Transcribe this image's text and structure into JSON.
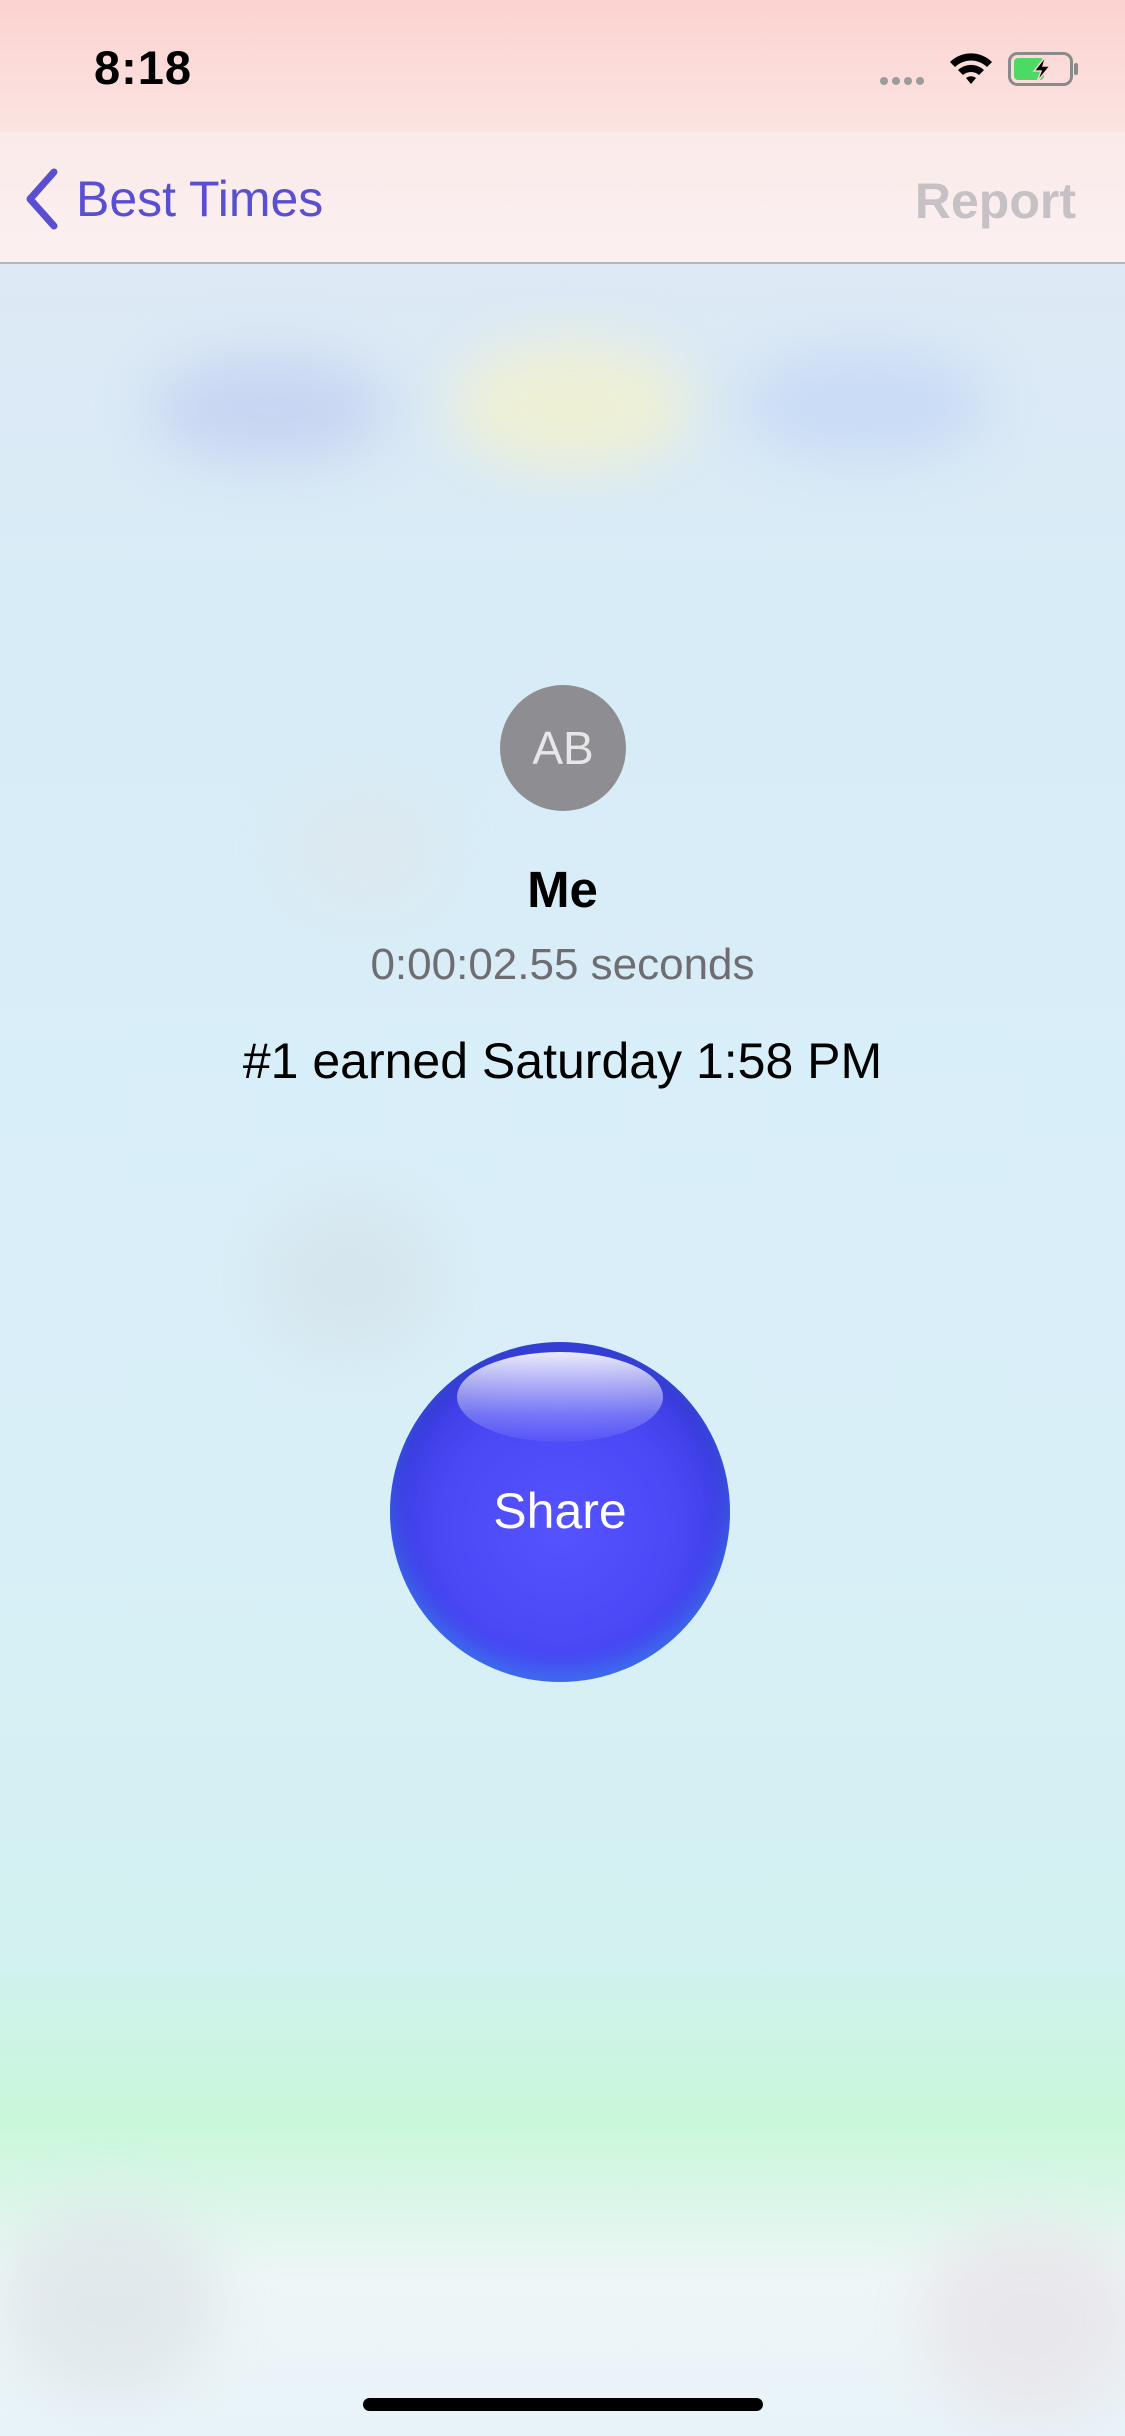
{
  "status_bar": {
    "time": "8:18",
    "icons": [
      "cellular-signal-icon",
      "wifi-icon",
      "battery-charging-icon"
    ]
  },
  "nav_bar": {
    "back_label": "Best Times",
    "report_label": "Report",
    "accent_color": "#5a4fd1",
    "disabled_color": "#c6c1c4"
  },
  "entry": {
    "avatar_initials": "AB",
    "name": "Me",
    "time": "0:00:02.55 seconds",
    "rank_text": "#1 earned Saturday 1:58 PM"
  },
  "share_button": {
    "label": "Share",
    "color": "#4a49f6"
  }
}
